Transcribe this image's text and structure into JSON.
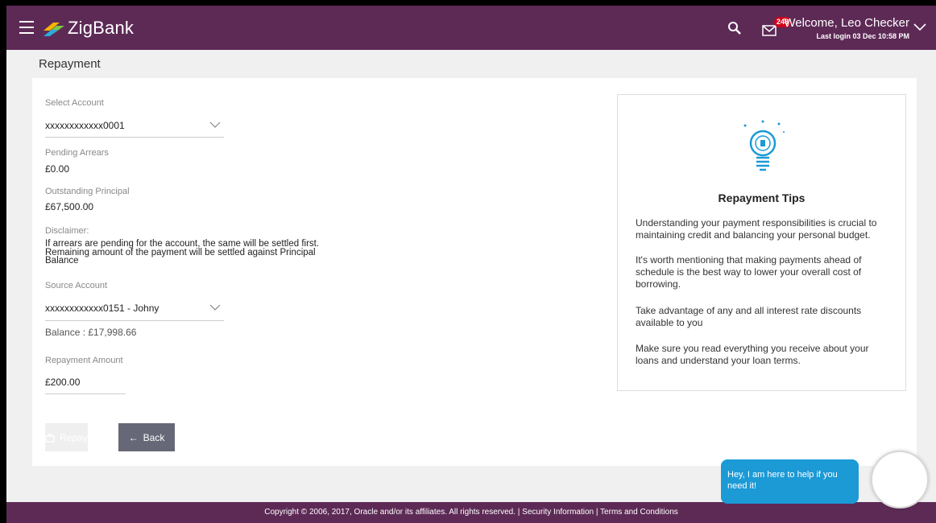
{
  "header": {
    "brand": "ZigBank",
    "mail_count": "248",
    "welcome": "Welcome, Leo Checker",
    "last_login": "Last login 03 Dec 10:58 PM"
  },
  "page": {
    "title": "Repayment"
  },
  "form": {
    "select_account_label": "Select Account",
    "select_account_value": "xxxxxxxxxxxx0001",
    "pending_arrears_label": "Pending Arrears",
    "pending_arrears_value": "£0.00",
    "outstanding_principal_label": "Outstanding Principal",
    "outstanding_principal_value": "£67,500.00",
    "disclaimer_label": "Disclaimer:",
    "disclaimer_text": "If arrears are pending for the account, the same will be settled first. Remaining amount of the payment will be settled against Principal Balance",
    "source_account_label": "Source Account",
    "source_account_value": "xxxxxxxxxxxx0151 - Johny",
    "balance": "Balance : £17,998.66",
    "repayment_amount_label": "Repayment Amount",
    "repayment_amount_value": "£200.00"
  },
  "buttons": {
    "repay": "Repay",
    "back": "Back"
  },
  "tips": {
    "title": "Repayment Tips",
    "items": [
      "Understanding your payment responsibilities is crucial to maintaining credit and balancing your personal budget.",
      "It's worth mentioning that making payments ahead of schedule is the best way to lower your overall cost of borrowing.",
      "Take advantage of any and all interest rate discounts available to you",
      "Make sure you read everything you receive about your loans and understand your loan terms."
    ]
  },
  "footer": {
    "text": "Copyright © 2006, 2017, Oracle and/or its affiliates. All rights reserved. | Security Information | Terms and Conditions"
  },
  "chat": {
    "message": "Hey, I am here to help if you need it!"
  },
  "colors": {
    "header": "#5d2a56",
    "primary_button": "#0a7f82",
    "secondary_button": "#676877",
    "chat": "#1b9ad6"
  }
}
